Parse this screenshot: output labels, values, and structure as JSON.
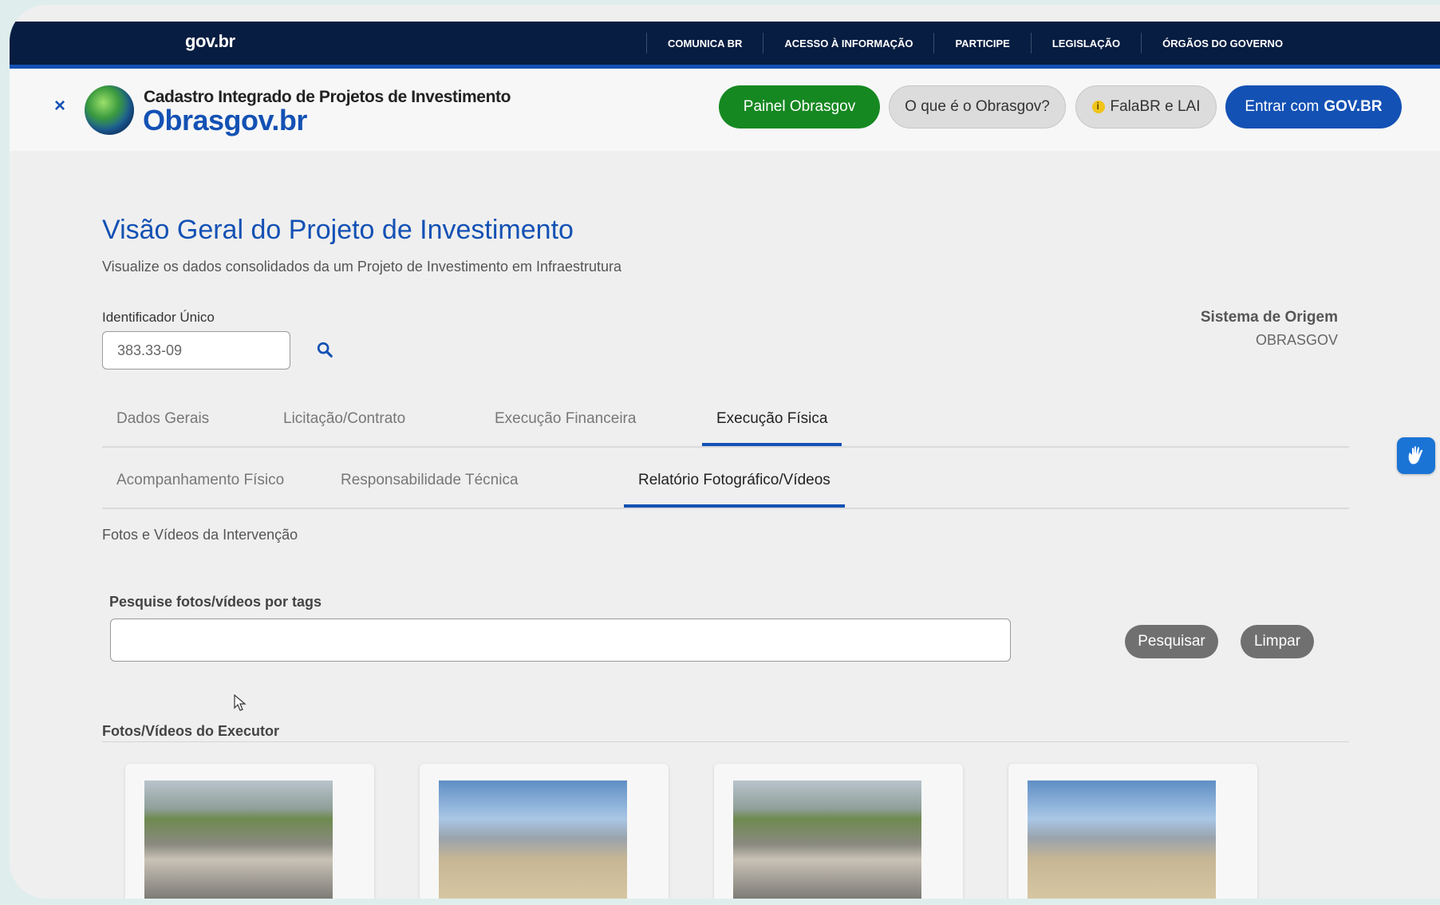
{
  "gov_header": {
    "logo": "gov.br",
    "links": [
      "COMUNICA BR",
      "ACESSO À INFORMAÇÃO",
      "PARTICIPE",
      "LEGISLAÇÃO",
      "ÓRGÃOS DO GOVERNO"
    ]
  },
  "site_header": {
    "close_icon": "×",
    "brand_subtitle": "Cadastro Integrado de Projetos de Investimento",
    "brand_title": "Obrasgov.br",
    "buttons": {
      "painel": "Painel Obrasgov",
      "o_que_e": "O que é o Obrasgov?",
      "falabr": "FalaBR e LAI",
      "entrar_prefix": "Entrar com",
      "entrar_bold": "GOV.BR"
    }
  },
  "page": {
    "title": "Visão Geral do Projeto de Investimento",
    "subtitle": "Visualize os dados consolidados da um Projeto de Investimento em Infraestrutura"
  },
  "identifier": {
    "label": "Identificador Único",
    "value": "383.33-09"
  },
  "origin": {
    "label": "Sistema de Origem",
    "value": "OBRASGOV"
  },
  "main_tabs": [
    {
      "label": "Dados Gerais",
      "active": false
    },
    {
      "label": "Licitação/Contrato",
      "active": false
    },
    {
      "label": "Execução Financeira",
      "active": false
    },
    {
      "label": "Execução Física",
      "active": true
    }
  ],
  "sub_tabs": [
    {
      "label": "Acompanhamento Físico",
      "active": false
    },
    {
      "label": "Responsabilidade Técnica",
      "active": false
    },
    {
      "label": "Relatório Fotográfico/Vídeos",
      "active": true
    }
  ],
  "media_section": {
    "note": "Fotos e Vídeos da Intervenção",
    "search_label": "Pesquise fotos/vídeos por tags",
    "search_value": "",
    "search_button": "Pesquisar",
    "clear_button": "Limpar",
    "executor_heading": "Fotos/Vídeos do Executor"
  },
  "colors": {
    "gov_blue": "#1351b4",
    "gov_dark": "#071d41",
    "green": "#168821"
  }
}
